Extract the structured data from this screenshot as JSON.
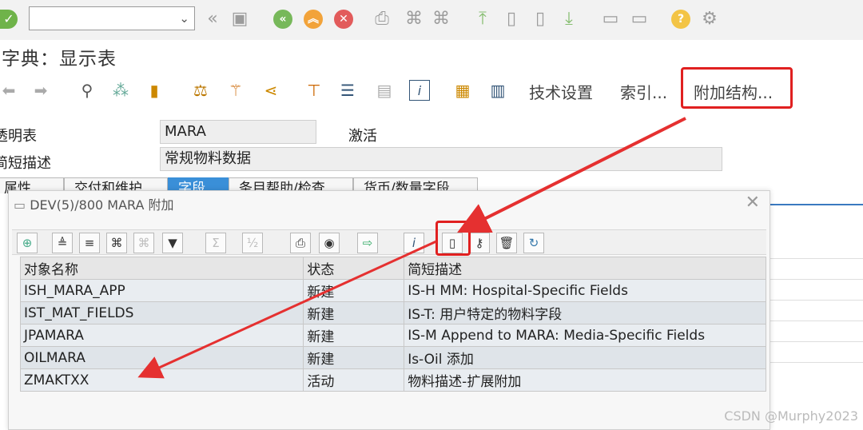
{
  "window": {
    "title": "字典：显示表"
  },
  "system_toolbar": {
    "command_field_value": "",
    "icons": [
      "enter-icon",
      "back-icon",
      "save-icon",
      "back-circle-icon",
      "exit-icon",
      "cancel-icon",
      "print-icon",
      "find-icon",
      "find-next-icon",
      "first-page-icon",
      "prev-page-icon",
      "next-page-icon",
      "last-page-icon",
      "new-session-icon",
      "shortcut-icon",
      "help-icon",
      "settings-icon"
    ]
  },
  "app_toolbar": {
    "technical_settings_label": "技术设置",
    "indexes_label": "索引...",
    "append_structure_label": "附加结构..."
  },
  "header": {
    "transparent_table_label": "透明表",
    "table_name": "MARA",
    "status": "激活",
    "short_desc_label": "简短描述",
    "short_desc_value": "常规物料数据"
  },
  "tabs": [
    {
      "label": "属性"
    },
    {
      "label": "交付和维护"
    },
    {
      "label": "字段"
    },
    {
      "label": "条目帮助/检查"
    },
    {
      "label": "货币/数量字段"
    }
  ],
  "popup": {
    "title": "DEV(5)/800 MARA 附加",
    "columns": [
      "对象名称",
      "状态",
      "简短描述"
    ],
    "rows": [
      {
        "name": "ISH_MARA_APP",
        "status": "新建",
        "desc": "IS-H MM: Hospital-Specific Fields"
      },
      {
        "name": "IST_MAT_FIELDS",
        "status": "新建",
        "desc": "IS-T: 用户特定的物料字段"
      },
      {
        "name": "JPAMARA",
        "status": "新建",
        "desc": "IS-M Append to MARA: Media-Specific Fields"
      },
      {
        "name": "OILMARA",
        "status": "新建",
        "desc": "Is-Oil 添加"
      },
      {
        "name": "ZMAKTXX",
        "status": "活动",
        "desc": "物料描述-扩展附加"
      }
    ]
  },
  "watermark": "CSDN @Murphy2023",
  "colors": {
    "highlight_red": "#e02020",
    "active_tab": "#3a8fd8"
  }
}
